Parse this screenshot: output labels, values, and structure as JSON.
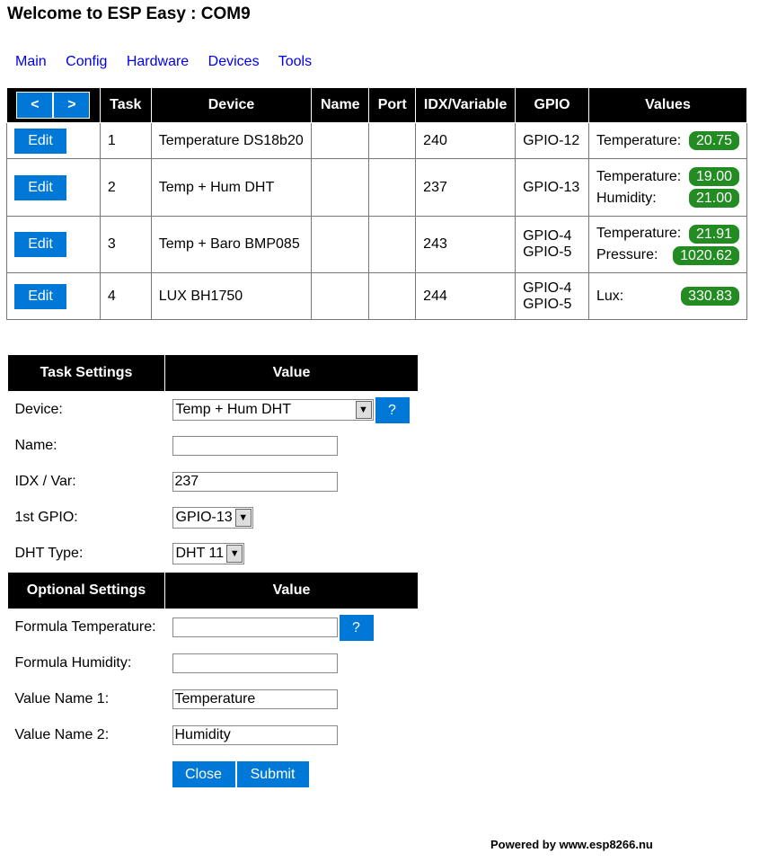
{
  "title": "Welcome to ESP Easy : COM9",
  "nav": [
    "Main",
    "Config",
    "Hardware",
    "Devices",
    "Tools"
  ],
  "devices": {
    "prev_label": "<",
    "next_label": ">",
    "headers": {
      "task": "Task",
      "device": "Device",
      "name": "Name",
      "port": "Port",
      "idx": "IDX/Variable",
      "gpio": "GPIO",
      "values": "Values"
    },
    "edit_label": "Edit",
    "rows": [
      {
        "task": "1",
        "device": "Temperature DS18b20",
        "name": "",
        "port": "",
        "idx": "240",
        "gpio": [
          "GPIO-12"
        ],
        "values": [
          {
            "label": "Temperature:",
            "value": "20.75"
          }
        ]
      },
      {
        "task": "2",
        "device": "Temp + Hum DHT",
        "name": "",
        "port": "",
        "idx": "237",
        "gpio": [
          "GPIO-13"
        ],
        "values": [
          {
            "label": "Temperature:",
            "value": "19.00"
          },
          {
            "label": "Humidity:",
            "value": "21.00"
          }
        ]
      },
      {
        "task": "3",
        "device": "Temp + Baro BMP085",
        "name": "",
        "port": "",
        "idx": "243",
        "gpio": [
          "GPIO-4",
          "GPIO-5"
        ],
        "values": [
          {
            "label": "Temperature:",
            "value": "21.91"
          },
          {
            "label": "Pressure:",
            "value": "1020.62"
          }
        ]
      },
      {
        "task": "4",
        "device": "LUX BH1750",
        "name": "",
        "port": "",
        "idx": "244",
        "gpio": [
          "GPIO-4",
          "GPIO-5"
        ],
        "values": [
          {
            "label": "Lux:",
            "value": "330.83"
          }
        ]
      }
    ]
  },
  "settings": {
    "task_header": "Task Settings",
    "value_header": "Value",
    "device_label": "Device:",
    "device_value": "Temp + Hum DHT",
    "help_label": "?",
    "name_label": "Name:",
    "name_value": "",
    "idx_label": "IDX / Var:",
    "idx_value": "237",
    "gpio_label": "1st GPIO:",
    "gpio_value": "GPIO-13",
    "dht_label": "DHT Type:",
    "dht_value": "DHT 11",
    "optional_header": "Optional Settings",
    "formula_temp_label": "Formula Temperature:",
    "formula_temp_value": "",
    "formula_hum_label": "Formula Humidity:",
    "formula_hum_value": "",
    "value_name1_label": "Value Name 1:",
    "value_name1_value": "Temperature",
    "value_name2_label": "Value Name 2:",
    "value_name2_value": "Humidity",
    "close_label": "Close",
    "submit_label": "Submit"
  },
  "footer": "Powered by www.esp8266.nu",
  "colors": {
    "button": "#0078d7",
    "badge": "#228b22",
    "header_bg": "#000000",
    "link": "#0000ee"
  }
}
